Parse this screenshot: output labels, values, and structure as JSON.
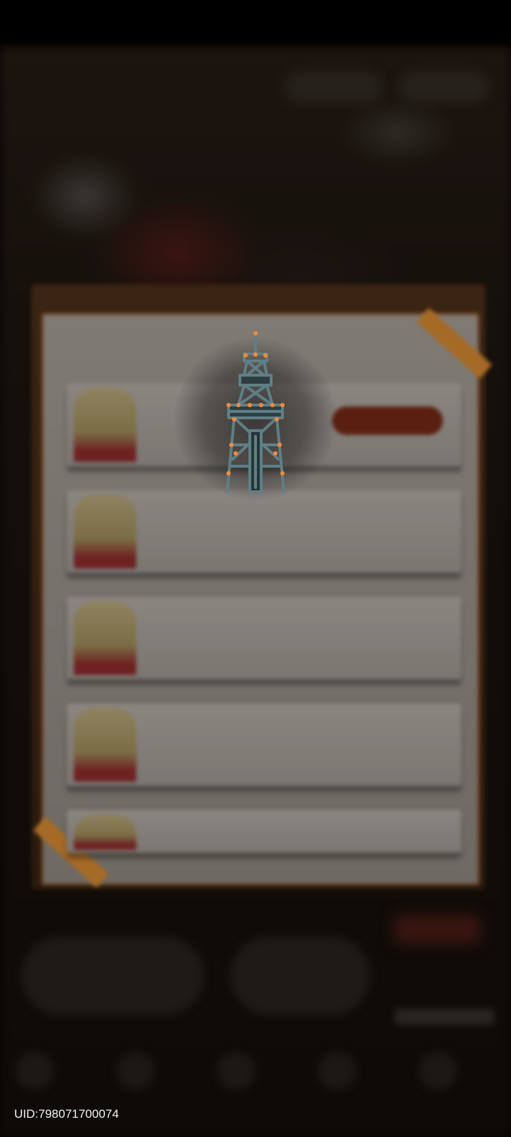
{
  "overlay": {
    "uid_label": "UID:798071700074"
  },
  "colors": {
    "panel_frame": "#3b2413",
    "panel_paper": "#7f7a74",
    "action_button": "#5a1f0f",
    "tower_steel": "#5f7f86",
    "tower_light": "#ff8a3a"
  },
  "icons": {
    "loading": "oil-derrick-tower-icon"
  }
}
